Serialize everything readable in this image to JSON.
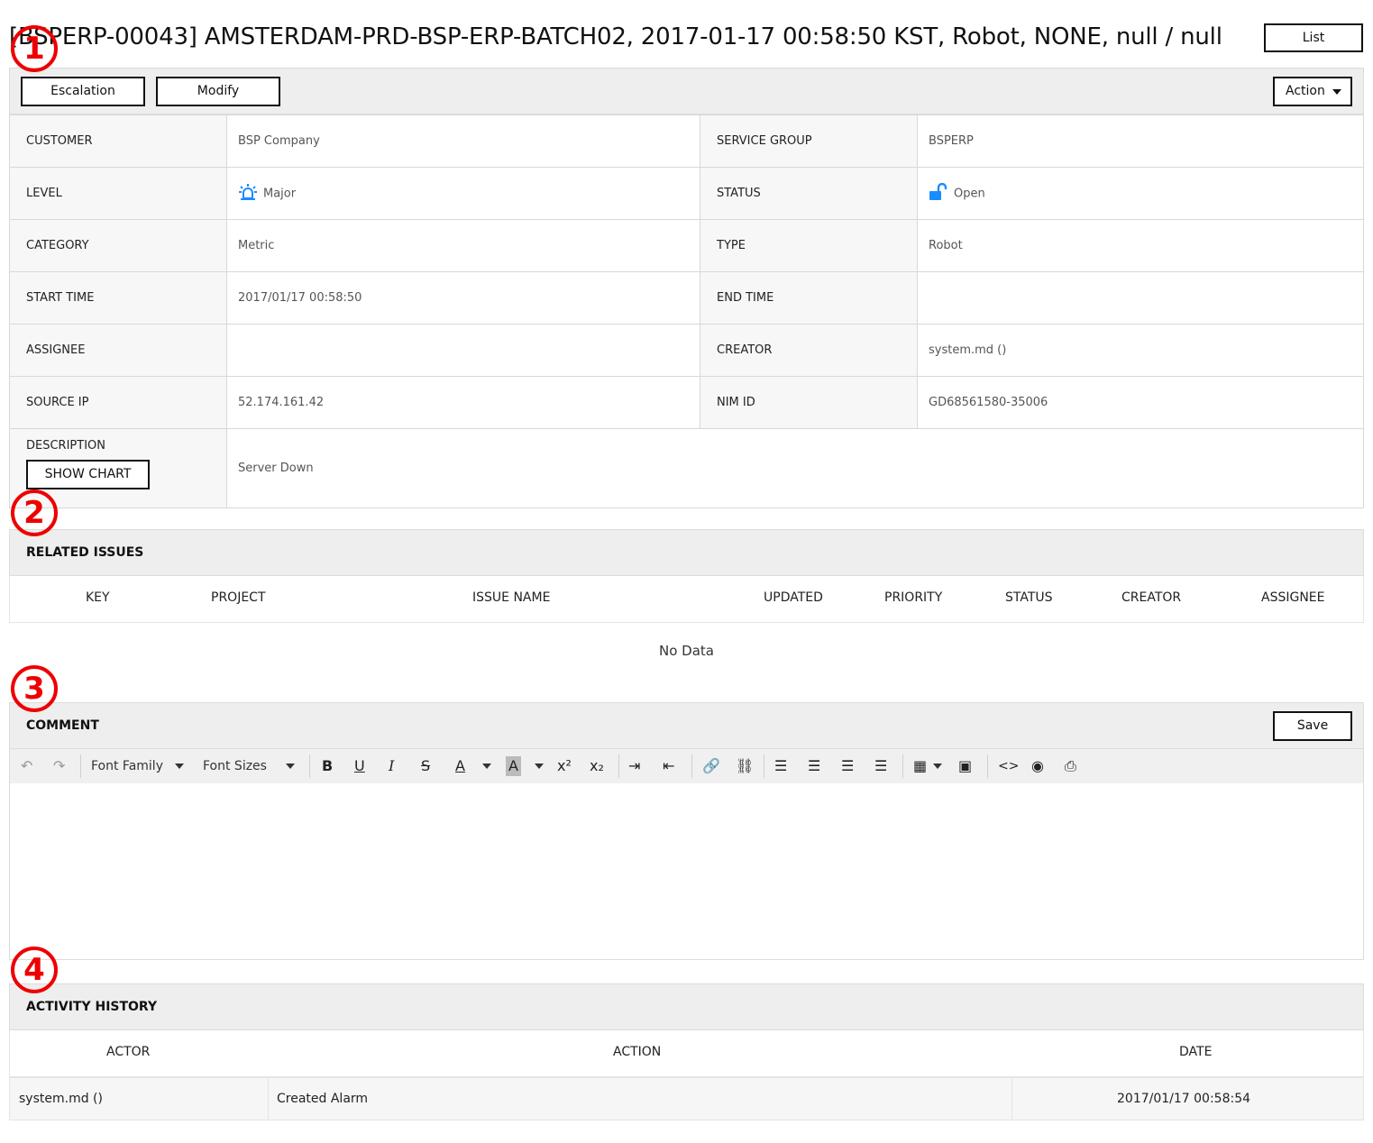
{
  "header": {
    "title": "[BSPERP-00043] AMSTERDAM-PRD-BSP-ERP-BATCH02, 2017-01-17 00:58:50 KST, Robot, NONE, null / null",
    "list_label": "List"
  },
  "toolbar": {
    "escalation_label": "Escalation",
    "modify_label": "Modify",
    "action_label": "Action"
  },
  "details": {
    "customer_label": "CUSTOMER",
    "customer": "BSP Company",
    "service_group_label": "SERVICE GROUP",
    "service_group": "BSPERP",
    "level_label": "LEVEL",
    "level": "Major",
    "status_label": "STATUS",
    "status": "Open",
    "category_label": "CATEGORY",
    "category": "Metric",
    "type_label": "TYPE",
    "type": "Robot",
    "start_time_label": "START TIME",
    "start_time": "2017/01/17 00:58:50",
    "end_time_label": "END TIME",
    "end_time": "",
    "assignee_label": "ASSIGNEE",
    "assignee": "",
    "creator_label": "CREATOR",
    "creator": "system.md ()",
    "source_ip_label": "SOURCE IP",
    "source_ip": "52.174.161.42",
    "nim_id_label": "NIM ID",
    "nim_id": "GD68561580-35006",
    "description_label": "DESCRIPTION",
    "description": "Server Down",
    "show_chart_label": "SHOW CHART"
  },
  "related": {
    "title": "RELATED ISSUES",
    "columns": [
      "KEY",
      "PROJECT",
      "ISSUE NAME",
      "UPDATED",
      "PRIORITY",
      "STATUS",
      "CREATOR",
      "ASSIGNEE"
    ],
    "empty_text": "No Data"
  },
  "comment": {
    "title": "COMMENT",
    "save_label": "Save",
    "font_family_label": "Font Family",
    "font_sizes_label": "Font Sizes"
  },
  "activity": {
    "title": "ACTIVITY HISTORY",
    "columns": [
      "ACTOR",
      "ACTION",
      "DATE"
    ],
    "rows": [
      {
        "actor": "system.md ()",
        "action": "Created Alarm",
        "date": "2017/01/17 00:58:54"
      }
    ]
  },
  "markers": [
    "1",
    "2",
    "3",
    "4"
  ],
  "icons": {
    "level": "siren-icon",
    "status": "unlock-icon"
  },
  "colors": {
    "marker": "#ee0000",
    "icon": "#1a8cff"
  }
}
